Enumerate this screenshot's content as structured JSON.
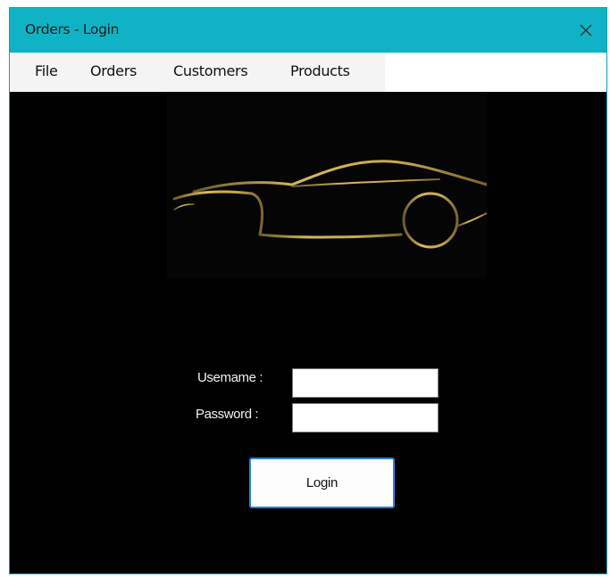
{
  "window": {
    "title": "Orders - Login",
    "close_glyph": "✕"
  },
  "menu": {
    "items": [
      {
        "label": "File"
      },
      {
        "label": "Orders"
      },
      {
        "label": "Customers"
      },
      {
        "label": "Products"
      }
    ]
  },
  "logo": {
    "icon": "sports-car-logo-icon",
    "color": "#c9a84a"
  },
  "form": {
    "username_label": "Usemame :",
    "username_value": "",
    "password_label": "Password :",
    "password_value": "",
    "login_label": "Login"
  },
  "colors": {
    "titlebar": "#10b3c5",
    "background": "#000000",
    "button_border": "#2b82d9"
  }
}
